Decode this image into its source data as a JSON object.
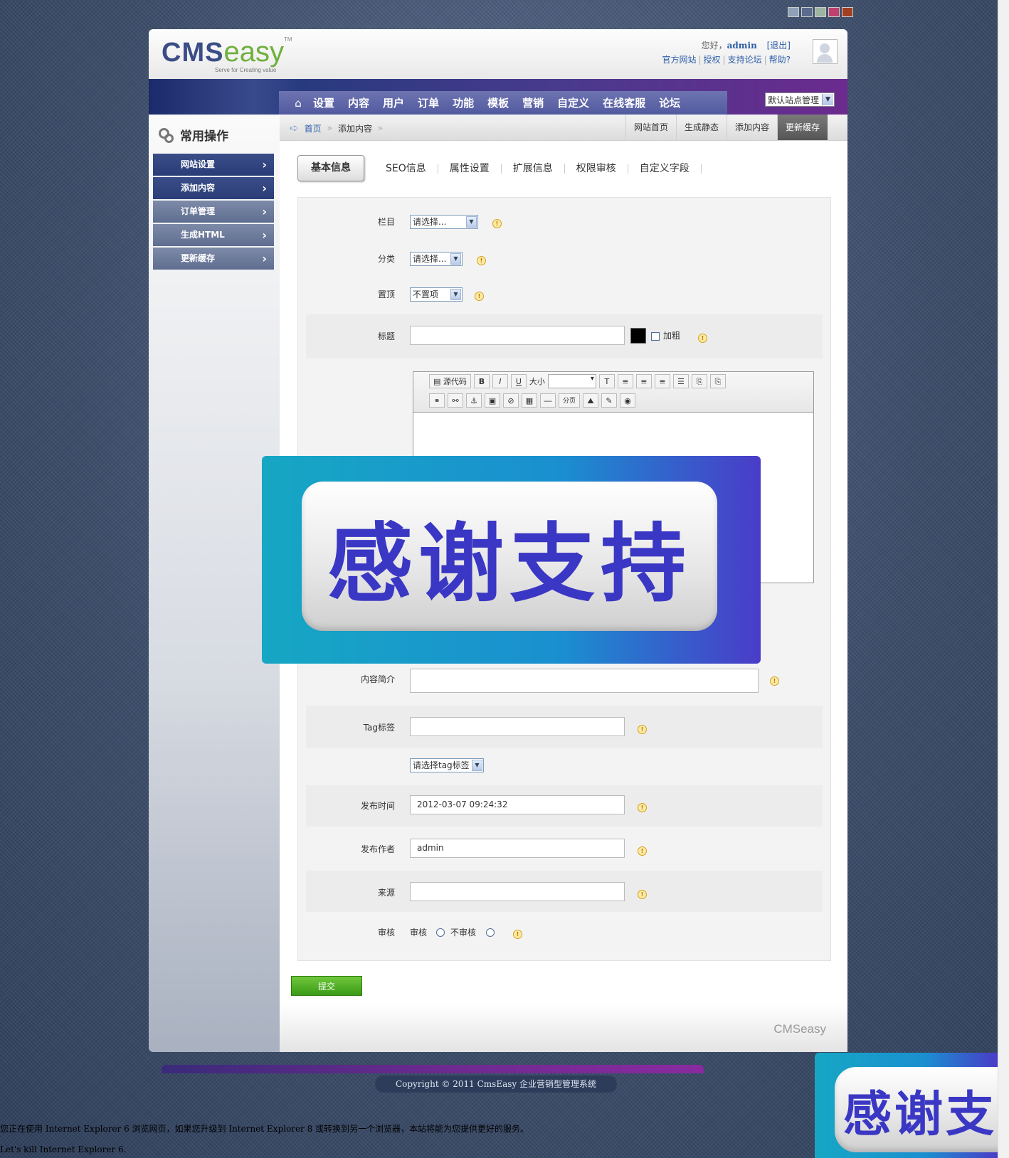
{
  "theme_swatches": [
    "#8fa0b8",
    "#5a6b8c",
    "#9fb4a0",
    "#c04070",
    "#a04020"
  ],
  "header": {
    "logo_cms": "CMS",
    "logo_easy": "easy",
    "logo_tm": "TM",
    "logo_tagline": "Serve for Creating value",
    "greeting": "您好，",
    "username": "admin",
    "logout": "[退出]",
    "links": [
      "官方网站",
      "授权",
      "支持论坛",
      "帮助?"
    ]
  },
  "nav": {
    "items": [
      "设置",
      "内容",
      "用户",
      "订单",
      "功能",
      "模板",
      "营销",
      "自定义",
      "在线客服",
      "论坛"
    ],
    "site_select": "默认站点管理"
  },
  "sidebar": {
    "title": "常用操作",
    "items": [
      {
        "label": "网站设置"
      },
      {
        "label": "添加内容"
      },
      {
        "label": "订单管理"
      },
      {
        "label": "生成HTML"
      },
      {
        "label": "更新缓存"
      }
    ]
  },
  "breadcrumb": {
    "home": "首页",
    "current": "添加内容"
  },
  "quick_links": [
    "网站首页",
    "生成静态",
    "添加内容",
    "更新缓存"
  ],
  "tabs": [
    "基本信息",
    "SEO信息",
    "属性设置",
    "扩展信息",
    "权限审核",
    "自定义字段"
  ],
  "form": {
    "column_label": "栏目",
    "column_value": "请选择...",
    "category_label": "分类",
    "category_value": "请选择...",
    "top_label": "置顶",
    "top_value": "不置项",
    "title_label": "标题",
    "title_value": "",
    "bold_label": "加粗",
    "summary_label": "内容简介",
    "tag_label": "Tag标签",
    "tag_select": "请选择tag标签",
    "pubtime_label": "发布时间",
    "pubtime_value": "2012-03-07 09:24:32",
    "author_label": "发布作者",
    "author_value": "admin",
    "source_label": "来源",
    "audit_label": "审核",
    "audit_yes": "审核",
    "audit_no": "不审核",
    "submit": "提交"
  },
  "editor": {
    "source_label": "源代码",
    "bold": "B",
    "italic": "I",
    "underline": "U",
    "size_label": "大小",
    "page_break": "分页"
  },
  "footer": {
    "logo": "CMSeasy",
    "copyright": "Copyright © 2011 CmsEasy 企业营销型管理系统"
  },
  "overlay_text": "感谢支持",
  "overlay_text_partial": "感谢支",
  "ie_warning": "您正在使用 Internet Explorer 6 浏览网页，如果您升级到 Internet Explorer 8 或转换到另一个浏览器，本站将能为您提供更好的服务。",
  "ie_warning_2": "Let's kill Internet Explorer 6."
}
